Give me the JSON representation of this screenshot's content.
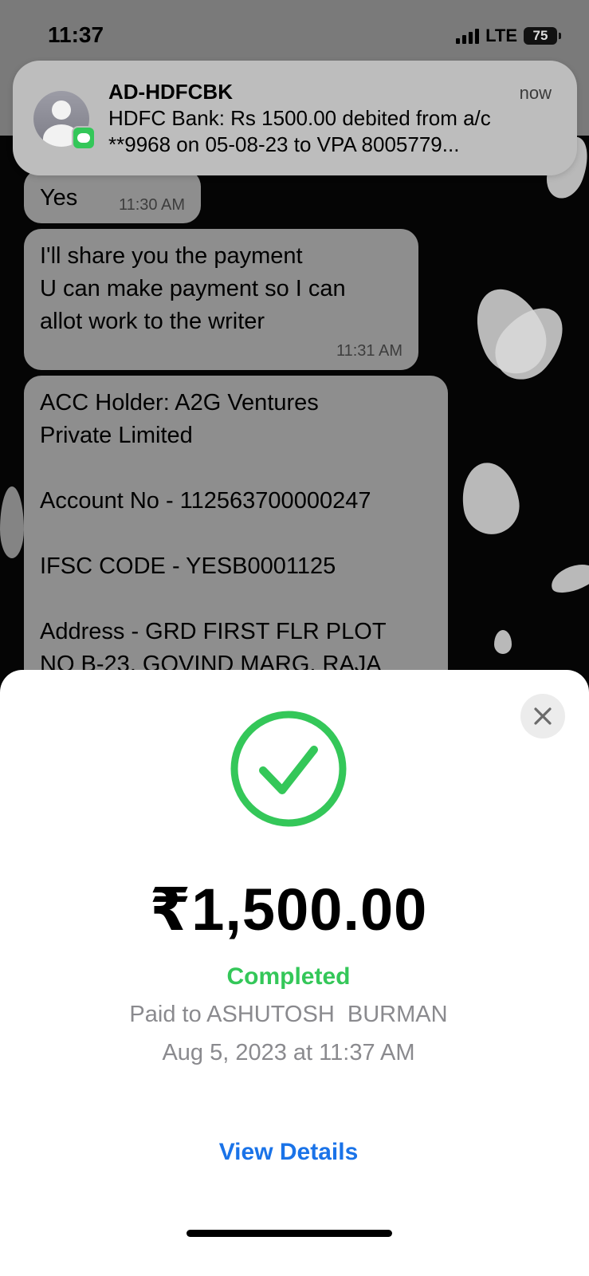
{
  "status_bar": {
    "time": "11:37",
    "network": "LTE",
    "battery": "75"
  },
  "notification": {
    "app_icon": "messages-icon",
    "sender": "AD-HDFCBK",
    "time": "now",
    "body_line1": "HDFC Bank: Rs 1500.00 debited from a/c",
    "body_line2": "**9968 on 05-08-23 to VPA 8005779..."
  },
  "chat": {
    "messages": [
      {
        "lines": [
          "Yes"
        ],
        "time": "11:30 AM"
      },
      {
        "lines": [
          "I'll share you the payment",
          "U can make payment so I can",
          "allot work to the writer"
        ],
        "time": "11:31 AM"
      },
      {
        "lines": [
          "ACC Holder: A2G Ventures",
          "Private Limited",
          "",
          "Account No -  112563700000247",
          "",
          "IFSC CODE - YESB0001125",
          "",
          "Address - GRD FIRST FLR PLOT",
          "NO B-23, GOVIND MARG, RAJA"
        ]
      }
    ]
  },
  "payment": {
    "amount": "₹1,500.00",
    "status": "Completed",
    "paid_to": "Paid to ASHUTOSH  BURMAN",
    "date": "Aug 5, 2023 at 11:37 AM",
    "view_details": "View Details",
    "status_color": "#34c759",
    "link_color": "#1a73e8"
  },
  "icons": {
    "close": "close-icon",
    "success": "checkmark-circle-icon"
  }
}
